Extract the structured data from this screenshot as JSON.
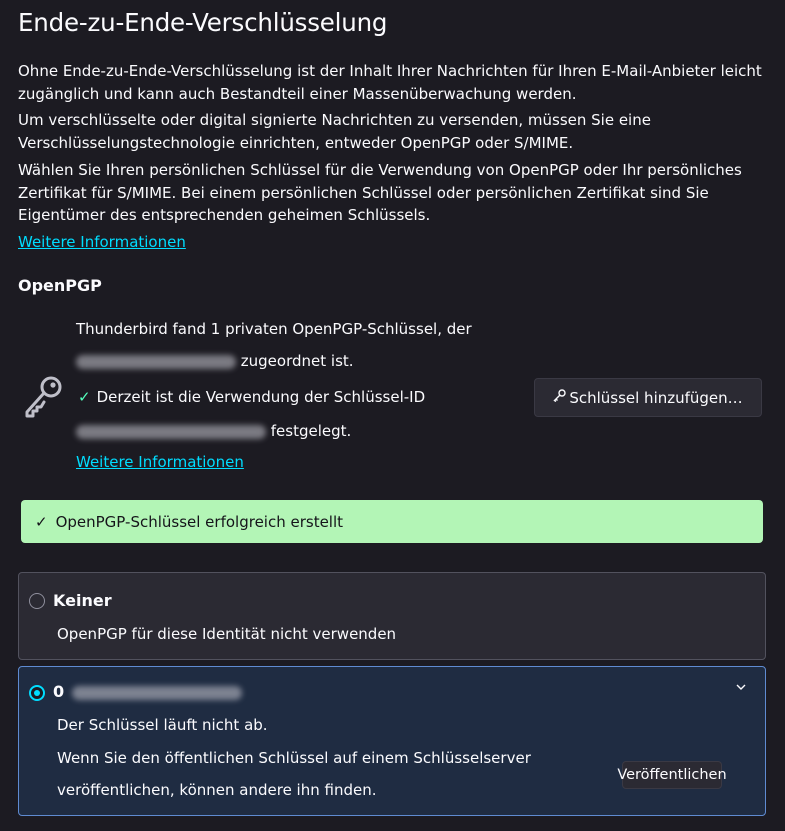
{
  "page": {
    "title": "Ende-zu-Ende-Verschlüsselung",
    "intro_1": "Ohne Ende-zu-Ende-Verschlüsselung ist der Inhalt Ihrer Nachrichten für Ihren E-Mail-Anbieter leicht zugänglich und kann auch Bestandteil einer Massenüberwachung werden.",
    "intro_2": "Um verschlüsselte oder digital signierte Nachrichten zu versenden, müssen Sie eine Verschlüsselungstechnologie einrichten, entweder OpenPGP oder S/MIME.",
    "intro_3": "Wählen Sie Ihren persönlichen Schlüssel für die Verwendung von OpenPGP oder Ihr persönliches Zertifikat für S/MIME. Bei einem persönlichen Schlüssel oder persönlichen Zertifikat sind Sie Eigentümer des entsprechenden geheimen Schlüssels.",
    "more_info": "Weitere Informationen"
  },
  "openpgp": {
    "heading": "OpenPGP",
    "found_line": "Thunderbird fand 1 privaten OpenPGP-Schlüssel, der",
    "assigned_suffix": "zugeordnet ist.",
    "check_mark": "✓",
    "current_line": "Derzeit ist die Verwendung der Schlüssel-ID",
    "set_suffix": "festgelegt.",
    "more_info": "Weitere Informationen",
    "add_key_button": "Schlüssel hinzufügen…",
    "icon": "key-icon"
  },
  "notification": {
    "check_mark": "✓",
    "text": "OpenPGP-Schlüssel erfolgreich erstellt"
  },
  "options": {
    "none": {
      "title": "Keiner",
      "description": "OpenPGP für diese Identität nicht verwenden",
      "selected": false
    },
    "key": {
      "id_visible": "0",
      "expiry": "Der Schlüssel läuft nicht ab.",
      "publish_text_1": "Wenn Sie den öffentlichen Schlüssel auf einem Schlüsselserver",
      "publish_text_2": "veröffentlichen, können andere ihn finden.",
      "publish_button": "Veröffentlichen",
      "selected": true
    }
  },
  "colors": {
    "background": "#1c1b22",
    "accent": "#00ddff",
    "success_bg": "#b3f5b6",
    "selected_card_bg": "#1f2c42",
    "selected_card_border": "#5f8bd1"
  }
}
